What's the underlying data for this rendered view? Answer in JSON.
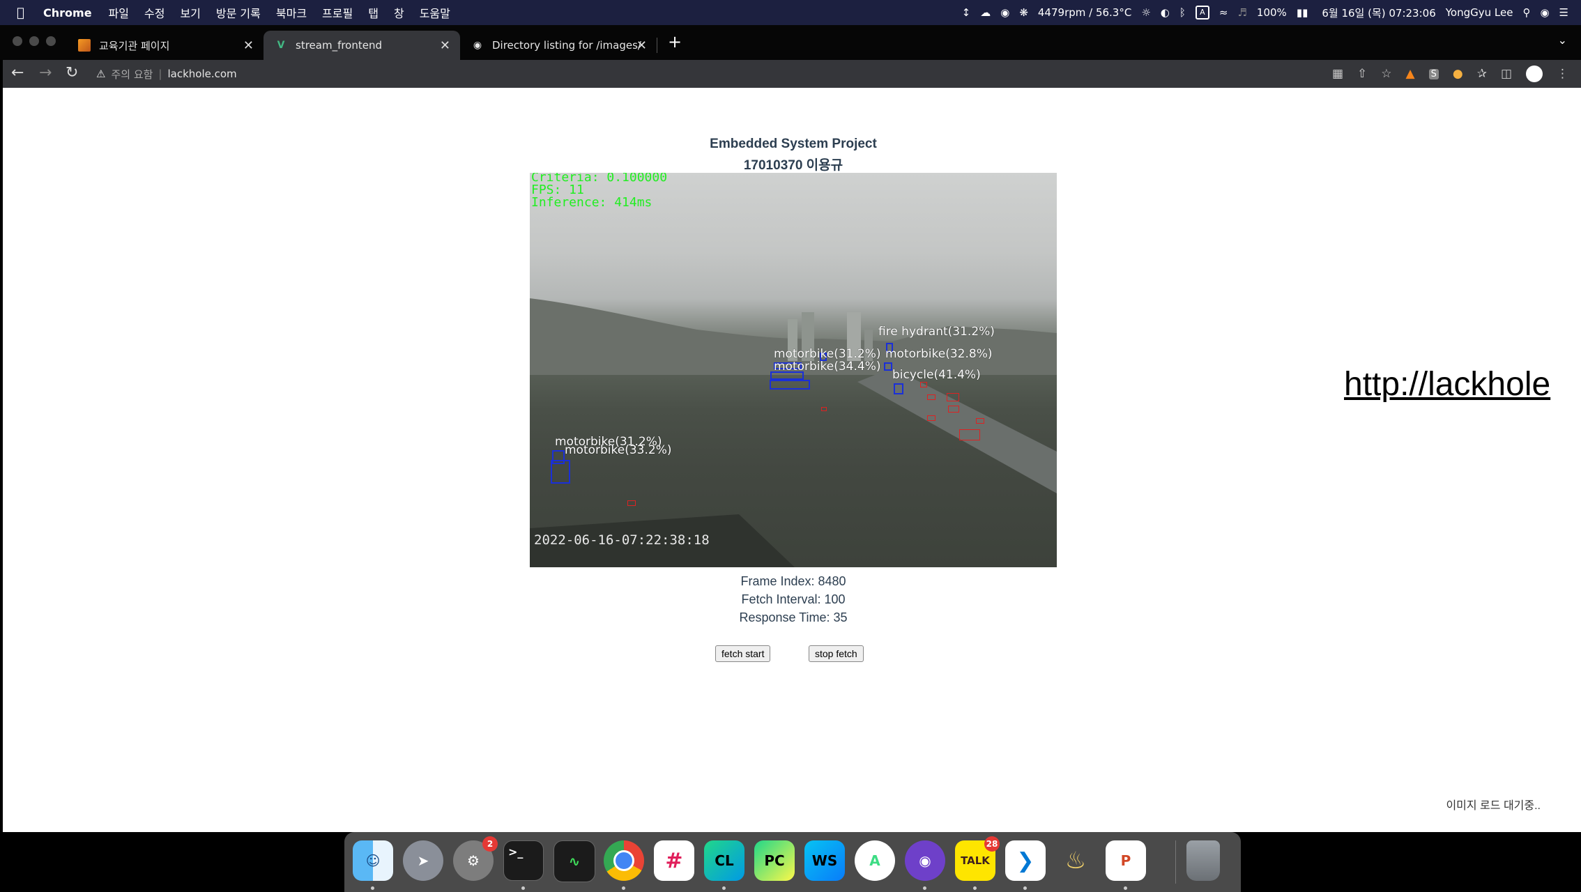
{
  "menubar": {
    "app_name": "Chrome",
    "items": [
      "파일",
      "수정",
      "보기",
      "방문 기록",
      "북마크",
      "프로필",
      "탭",
      "창",
      "도움말"
    ],
    "fan_status": "4479rpm / 56.3°C",
    "battery": "100%",
    "datetime": "6월 16일 (목) 07:23:06",
    "user": "YongGyu Lee",
    "input_source": "A"
  },
  "tabs": [
    {
      "title": "교육기관 페이지",
      "favicon": "orange-page-icon"
    },
    {
      "title": "stream_frontend",
      "favicon": "vue-logo-icon"
    },
    {
      "title": "Directory listing for /images/",
      "favicon": "globe-icon"
    }
  ],
  "toolbar": {
    "security_label": "주의 요함",
    "url": "lackhole.com"
  },
  "page": {
    "title": "Embedded System Project",
    "subtitle": "17010370 이용규",
    "frame_index": "Frame Index: 8480",
    "fetch_interval": "Fetch Interval: 100",
    "response_time": "Response Time: 35",
    "fetch_start_label": "fetch start",
    "stop_fetch_label": "stop fetch",
    "side_url": "http://lackhole",
    "loading_status": "이미지 로드 대기중.."
  },
  "stream": {
    "criteria": "Criteria: 0.100000",
    "fps": "FPS: 11",
    "inference": "Inference: 414ms",
    "timestamp": "2022-06-16-07:22:38:18",
    "detections": [
      "fire hydrant(31.2%)",
      "motorbike(31.2%)",
      "motorbike(32.8%)",
      "motorbike(34.4%)",
      "bicycle(41.4%)",
      "motorbike(31.2%)",
      "motorbike(33.2%)"
    ]
  },
  "dock": {
    "apps": [
      "Finder",
      "Launchpad",
      "System Preferences",
      "Terminal",
      "Activity Monitor",
      "Chrome",
      "Slack",
      "CLion",
      "PyCharm",
      "WebStorm",
      "Android Studio",
      "GitHub Desktop",
      "KakaoTalk",
      "VS Code",
      "Pasta",
      "PowerPoint",
      "Trash"
    ],
    "settings_badge": "2",
    "talk_badge": "28"
  }
}
